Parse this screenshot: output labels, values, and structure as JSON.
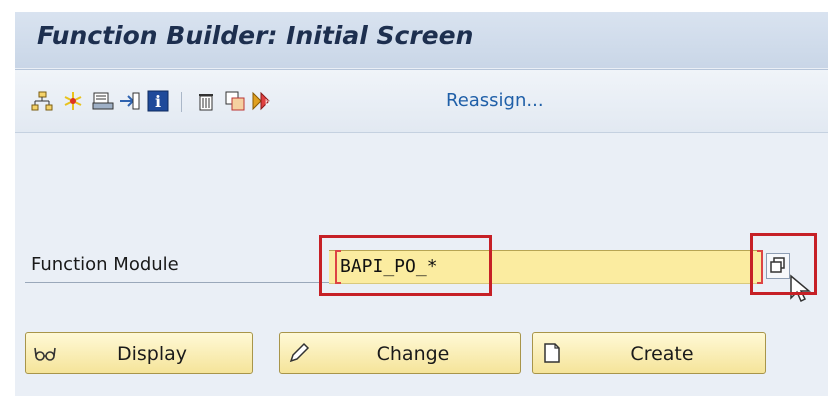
{
  "window": {
    "title": "Function Builder: Initial Screen"
  },
  "toolbar": {
    "icons": [
      "hierarchy-icon",
      "sparkle-icon",
      "print-icon",
      "where-used-icon",
      "info-icon",
      "delete-icon",
      "copy-icon",
      "rename-icon"
    ],
    "reassign_label": "Reassign..."
  },
  "form": {
    "function_module_label": "Function Module",
    "function_module_value": "BAPI_PO_*"
  },
  "buttons": {
    "display": "Display",
    "change": "Change",
    "create": "Create"
  },
  "colors": {
    "title_text": "#1d2f4f",
    "link": "#1f5fa8",
    "input_background": "#fbeca0",
    "highlight": "#c62026",
    "button": "#f5e49a"
  }
}
